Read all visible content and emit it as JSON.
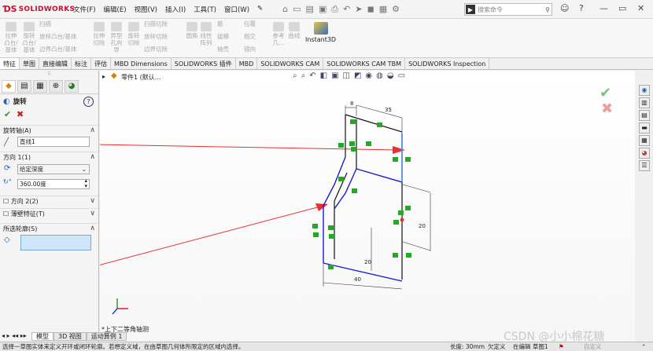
{
  "app": {
    "brand": "SOLIDWORKS"
  },
  "menu": [
    "文件(F)",
    "编辑(E)",
    "视图(V)",
    "插入(I)",
    "工具(T)",
    "窗口(W)"
  ],
  "search": {
    "placeholder": "搜索命令"
  },
  "ribbon": {
    "extrude_boss": "拉伸凸台/基体",
    "revolve_boss": "旋转凸台/基体",
    "sweep": "扫描",
    "loft_boss": "放样凸台/基体",
    "boundary_boss": "边界凸台/基体",
    "extrude_cut": "拉伸切除",
    "hole_wizard": "异型孔向导",
    "revolve_cut": "旋转切除",
    "sweep_cut": "扫描切除",
    "loft_cut": "放样切除",
    "boundary_cut": "边界切除",
    "fillet": "圆角",
    "linear_pattern": "线性阵列",
    "rib": "筋",
    "draft": "拔模",
    "shell": "抽壳",
    "wrap": "包覆",
    "intersect": "相交",
    "mirror": "镜向",
    "ref_geometry": "参考几...",
    "curves": "曲线",
    "instant3d": "Instant3D"
  },
  "tabs": [
    "特征",
    "草图",
    "直接编辑",
    "标注",
    "评估",
    "MBD Dimensions",
    "SOLIDWORKS 插件",
    "MBD",
    "SOLIDWORKS CAM",
    "SOLIDWORKS CAM TBM",
    "SOLIDWORKS Inspection"
  ],
  "feature_tree": {
    "breadcrumb": "零件1 (默认..."
  },
  "property_manager": {
    "title": "旋转",
    "axis_section": "旋转轴(A)",
    "axis_value": "直线1",
    "direction1_section": "方向 1(1)",
    "end_condition": "给定深度",
    "angle": "360.00度",
    "direction2": "方向 2(2)",
    "thin_feature": "薄壁特征(T)",
    "selected_contours": "所选轮廓(S)"
  },
  "dimensions": {
    "d1": "8",
    "d2": "35",
    "d3": "20",
    "d4": "20",
    "d5": "40"
  },
  "view_label": "*上下二等角轴测",
  "bottom_tabs": [
    "模型",
    "3D 视图",
    "运动算例 1"
  ],
  "status": {
    "message": "选择一草图实体来定义开环或闭环轮廓。若想定义域，在由草图几何体所限定的区域内选择。",
    "length": "长度: 30mm",
    "defined": "欠定义",
    "editing": "在编辑 草图1",
    "custom": "自定义"
  },
  "watermark": "CSDN @小小棉花糖",
  "colors": {
    "accent_red": "#c8102e",
    "sketch_blue": "#1a1acc",
    "relation_green": "#22aa22",
    "arrow_red": "#e83030"
  }
}
